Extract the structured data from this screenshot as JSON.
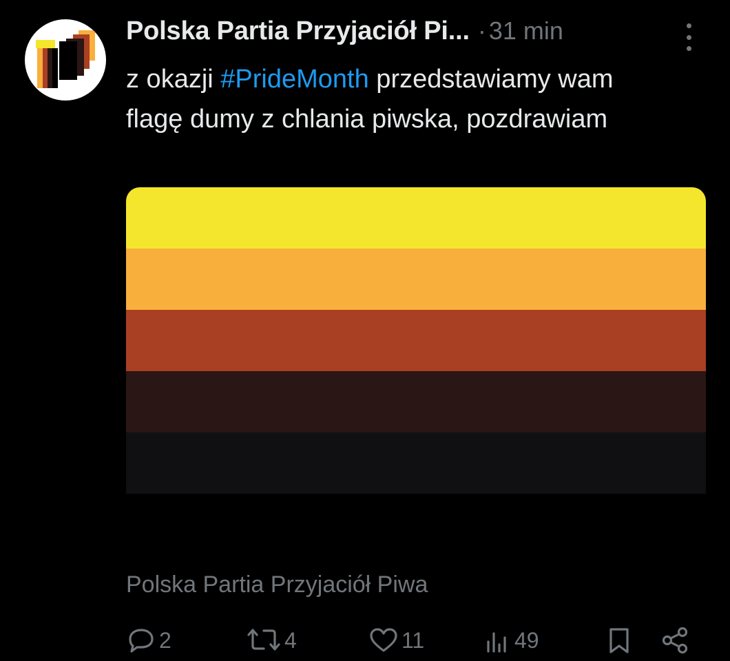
{
  "tweet": {
    "author_name": "Polska Partia Przyjaciół Pi...",
    "separator": "·",
    "time_ago": "31 min",
    "text_before": "z okazji ",
    "hashtag": "#PrideMonth",
    "text_after": " przedstawiamy wam flagę dumy z chlania piwska, pozdrawiam",
    "source_label": "Polska Partia Przyjaciół Piwa"
  },
  "flag": {
    "stripes": [
      {
        "name": "yellow",
        "color": "#f4e62c"
      },
      {
        "name": "light-orange",
        "color": "#f8af3c"
      },
      {
        "name": "rust",
        "color": "#a93f23"
      },
      {
        "name": "dark-brown",
        "color": "#2a1614"
      },
      {
        "name": "near-black",
        "color": "#101012"
      }
    ]
  },
  "actions": {
    "reply": {
      "icon": "reply-icon",
      "count": "2"
    },
    "retweet": {
      "icon": "retweet-icon",
      "count": "4"
    },
    "like": {
      "icon": "heart-icon",
      "count": "11"
    },
    "views": {
      "icon": "views-icon",
      "count": "49"
    },
    "bookmark": {
      "icon": "bookmark-icon"
    },
    "share": {
      "icon": "share-icon"
    }
  },
  "colors": {
    "background": "#000000",
    "text": "#e7e9ea",
    "muted": "#71767b",
    "link": "#1d9bf0"
  }
}
